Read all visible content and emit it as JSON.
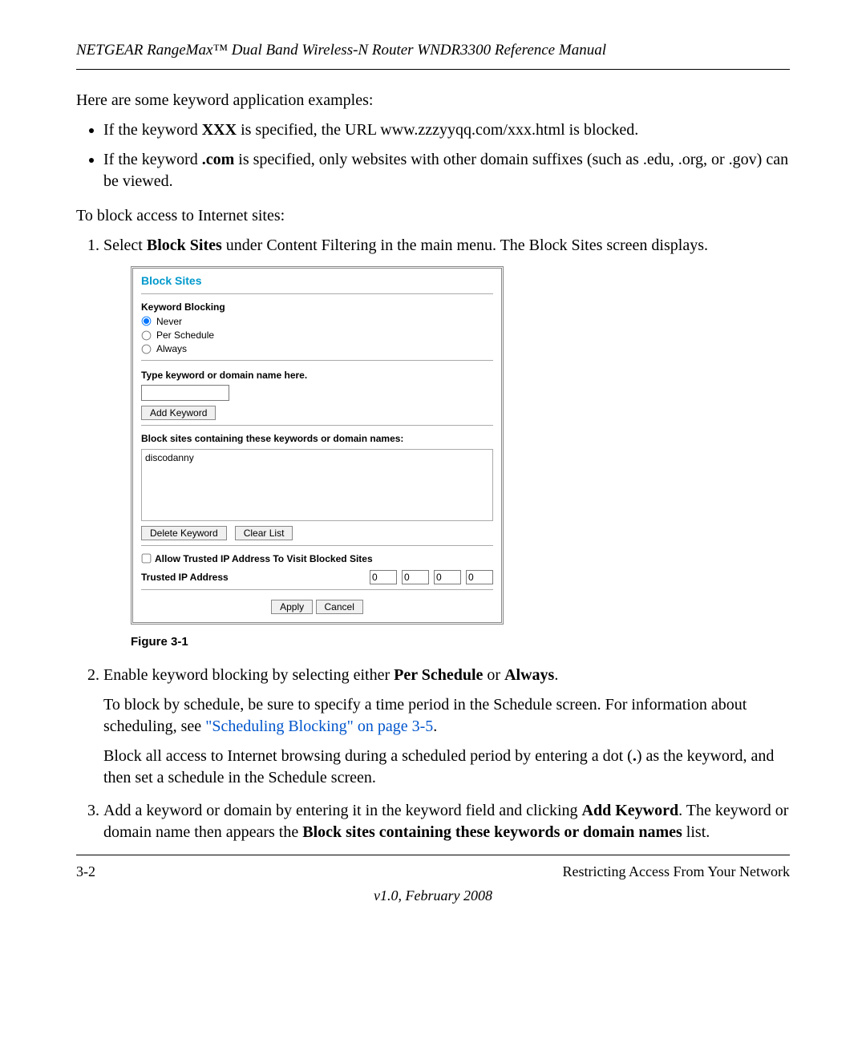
{
  "header": {
    "title": "NETGEAR RangeMax™ Dual Band Wireless-N Router WNDR3300 Reference Manual"
  },
  "intro": "Here are some keyword application examples:",
  "bullets": [
    {
      "pre": "If the keyword ",
      "bold": "XXX",
      "post": " is specified, the URL www.zzzyyqq.com/xxx.html is blocked."
    },
    {
      "pre": "If the keyword ",
      "bold": ".com",
      "post": " is specified, only websites with other domain suffixes (such as .edu, .org, or .gov) can be viewed."
    }
  ],
  "toblock": "To block access to Internet sites:",
  "step1": {
    "pre": "Select ",
    "bold": "Block Sites",
    "post": " under Content Filtering in the main menu. The Block Sites screen displays."
  },
  "panel": {
    "title": "Block Sites",
    "kb_heading": "Keyword Blocking",
    "radios": {
      "never": "Never",
      "perschedule": "Per Schedule",
      "always": "Always"
    },
    "type_label": "Type keyword or domain name here.",
    "add_keyword": "Add Keyword",
    "list_label": "Block sites containing these keywords or domain names:",
    "list_item": "discodanny",
    "delete_keyword": "Delete Keyword",
    "clear_list": "Clear List",
    "allow_trusted": "Allow Trusted IP Address To Visit Blocked Sites",
    "trusted_label": "Trusted IP Address",
    "ip": [
      "0",
      "0",
      "0",
      "0"
    ],
    "apply": "Apply",
    "cancel": "Cancel"
  },
  "figure_caption": "Figure 3-1",
  "step2": {
    "line1_pre": "Enable keyword blocking by selecting either ",
    "line1_b1": "Per Schedule",
    "line1_mid": " or ",
    "line1_b2": "Always",
    "line1_post": ".",
    "para2_pre": "To block by schedule, be sure to specify a time period in the Schedule screen. For information about scheduling, see ",
    "para2_link": "\"Scheduling Blocking\" on page 3-5",
    "para2_post": ".",
    "para3_pre": "Block all access to Internet browsing during a scheduled period by entering a dot (",
    "para3_bold": ".",
    "para3_post": ") as the keyword, and then set a schedule in the Schedule screen."
  },
  "step3": {
    "pre": "Add a keyword or domain by entering it in the keyword field and clicking ",
    "b1": "Add Keyword",
    "mid": ". The keyword or domain name then appears the ",
    "b2": "Block sites containing these keywords or domain names",
    "post": " list."
  },
  "footer": {
    "page": "3-2",
    "section": "Restricting Access From Your Network",
    "version": "v1.0, February 2008"
  }
}
